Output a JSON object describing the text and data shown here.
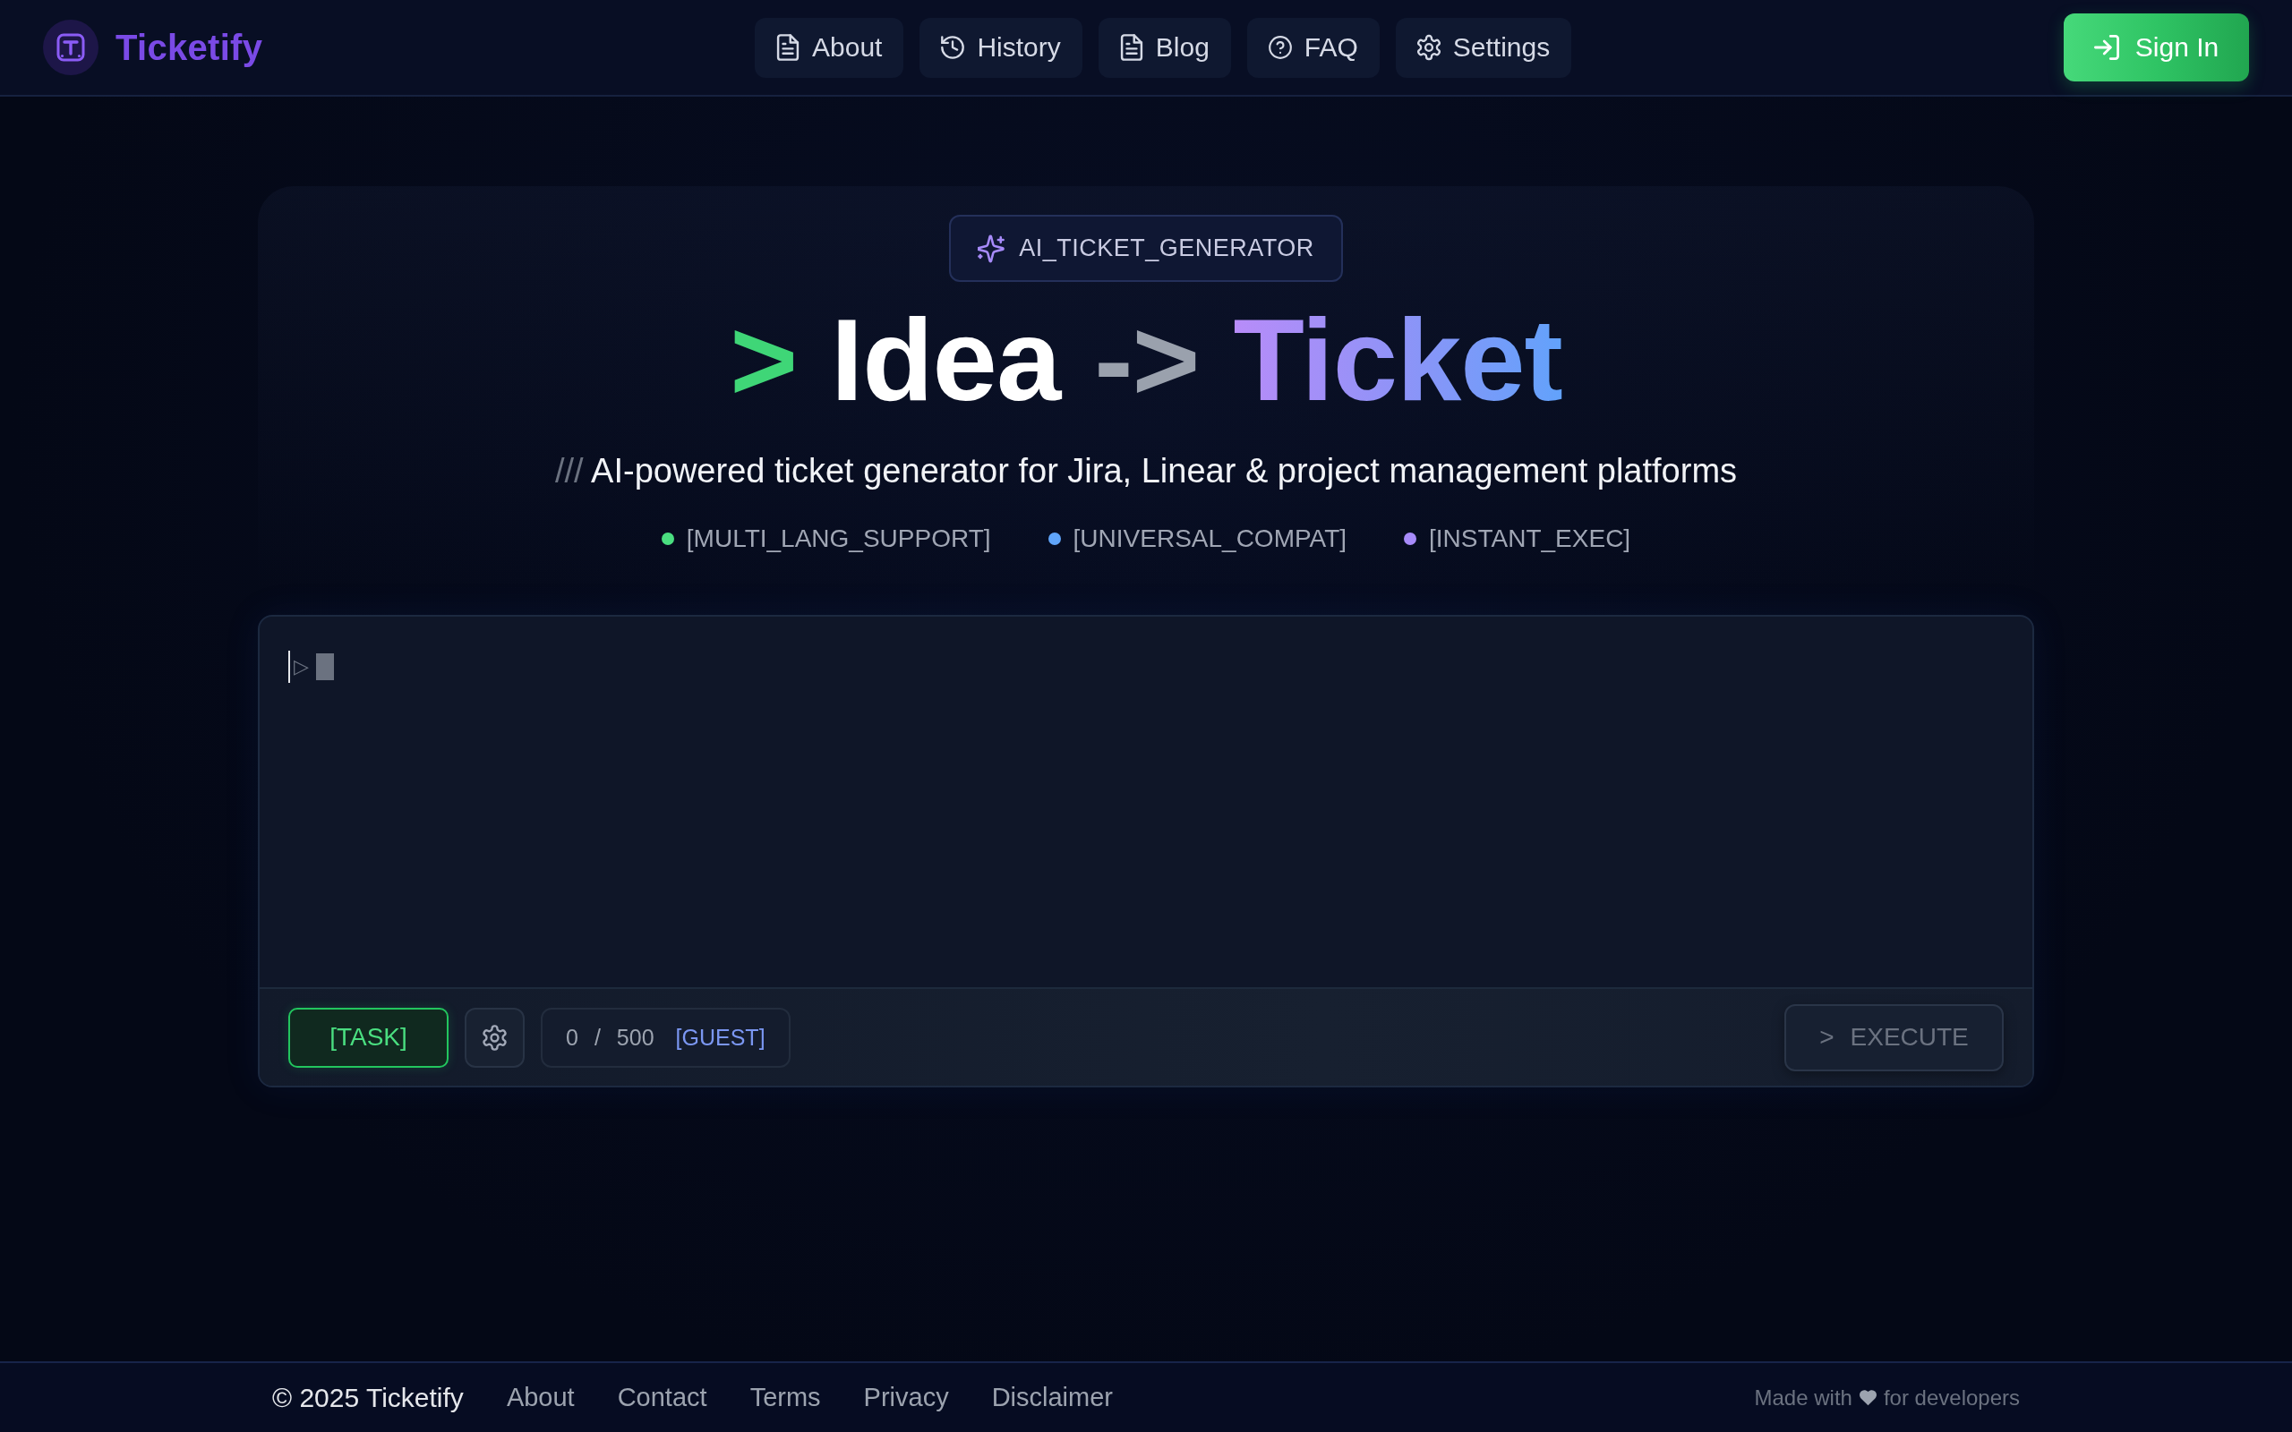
{
  "header": {
    "logo": "Ticketify",
    "nav": [
      {
        "label": "About",
        "kind": "document"
      },
      {
        "label": "History",
        "kind": "history"
      },
      {
        "label": "Blog",
        "kind": "document"
      },
      {
        "label": "FAQ",
        "kind": "help"
      },
      {
        "label": "Settings",
        "kind": "settings"
      }
    ],
    "sign_in": "Sign In"
  },
  "hero": {
    "badge": "AI_TICKET_GENERATOR",
    "title": [
      {
        "text": ">",
        "kind": "prompt"
      },
      {
        "text": "Idea",
        "kind": "plain"
      },
      {
        "text": "->",
        "kind": "arrow"
      },
      {
        "text": "Ticket",
        "kind": "gradient"
      }
    ],
    "subtitle": {
      "prefix": "///",
      "text": "AI-powered ticket generator for Jira, Linear & project management platforms"
    },
    "features": [
      {
        "label": "[MULTI_LANG_SUPPORT]",
        "color": "#4ade80"
      },
      {
        "label": "[UNIVERSAL_COMPAT]",
        "color": "#60a5fa"
      },
      {
        "label": "[INSTANT_EXEC]",
        "color": "#a78bfa"
      }
    ]
  },
  "editor": {
    "placeholder": "▷",
    "mode": "[TASK]",
    "counter": {
      "count": "0",
      "separator": "/",
      "limit": "500",
      "tier": "[GUEST]"
    },
    "execute": {
      "prefix": ">",
      "label": "EXECUTE",
      "disabled": true
    }
  },
  "footer": {
    "copyright": "© 2025 Ticketify",
    "links": [
      "About",
      "Contact",
      "Terms",
      "Privacy",
      "Disclaimer"
    ],
    "credit": {
      "before": "Made with",
      "after": "for developers"
    }
  }
}
